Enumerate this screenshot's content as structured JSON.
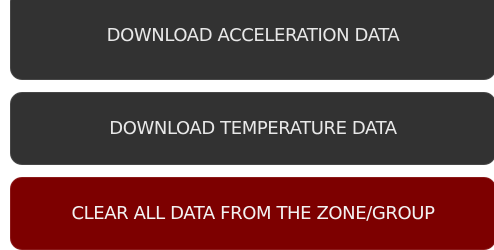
{
  "buttons": {
    "download_acceleration": {
      "label": "DOWNLOAD ACCELERATION DATA"
    },
    "download_temperature": {
      "label": "DOWNLOAD TEMPERATURE DATA"
    },
    "clear_all": {
      "label": "CLEAR ALL DATA FROM THE ZONE/GROUP"
    }
  },
  "colors": {
    "button_background": "#323232",
    "danger_background": "#7d0000",
    "text": "#e8e8e8"
  }
}
